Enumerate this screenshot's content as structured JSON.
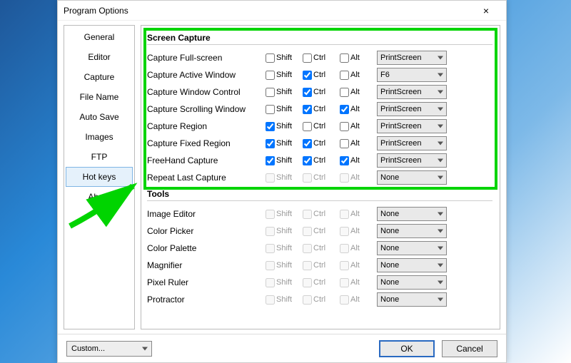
{
  "window": {
    "title": "Program Options",
    "close": "×"
  },
  "tabs": [
    {
      "label": "General"
    },
    {
      "label": "Editor"
    },
    {
      "label": "Capture"
    },
    {
      "label": "File Name"
    },
    {
      "label": "Auto Save"
    },
    {
      "label": "Images"
    },
    {
      "label": "FTP"
    },
    {
      "label": "Hot keys",
      "selected": true
    },
    {
      "label": "About"
    }
  ],
  "modlabels": {
    "shift": "Shift",
    "ctrl": "Ctrl",
    "alt": "Alt"
  },
  "groups": [
    {
      "title": "Screen Capture",
      "highlighted": true,
      "rows": [
        {
          "label": "Capture Full-screen",
          "shift": false,
          "ctrl": false,
          "alt": false,
          "key": "PrintScreen",
          "enabled": true
        },
        {
          "label": "Capture Active Window",
          "shift": false,
          "ctrl": true,
          "alt": false,
          "key": "F6",
          "enabled": true
        },
        {
          "label": "Capture Window Control",
          "shift": false,
          "ctrl": true,
          "alt": false,
          "key": "PrintScreen",
          "enabled": true
        },
        {
          "label": "Capture Scrolling Window",
          "shift": false,
          "ctrl": true,
          "alt": true,
          "key": "PrintScreen",
          "enabled": true
        },
        {
          "label": "Capture Region",
          "shift": true,
          "ctrl": false,
          "alt": false,
          "key": "PrintScreen",
          "enabled": true
        },
        {
          "label": "Capture Fixed Region",
          "shift": true,
          "ctrl": true,
          "alt": false,
          "key": "PrintScreen",
          "enabled": true
        },
        {
          "label": "FreeHand Capture",
          "shift": true,
          "ctrl": true,
          "alt": true,
          "key": "PrintScreen",
          "enabled": true
        },
        {
          "label": "Repeat Last Capture",
          "shift": false,
          "ctrl": false,
          "alt": false,
          "key": "None",
          "enabled": false
        }
      ]
    },
    {
      "title": "Tools",
      "highlighted": false,
      "rows": [
        {
          "label": "Image Editor",
          "shift": false,
          "ctrl": false,
          "alt": false,
          "key": "None",
          "enabled": false
        },
        {
          "label": "Color Picker",
          "shift": false,
          "ctrl": false,
          "alt": false,
          "key": "None",
          "enabled": false
        },
        {
          "label": "Color Palette",
          "shift": false,
          "ctrl": false,
          "alt": false,
          "key": "None",
          "enabled": false
        },
        {
          "label": "Magnifier",
          "shift": false,
          "ctrl": false,
          "alt": false,
          "key": "None",
          "enabled": false
        },
        {
          "label": "Pixel Ruler",
          "shift": false,
          "ctrl": false,
          "alt": false,
          "key": "None",
          "enabled": false
        },
        {
          "label": "Protractor",
          "shift": false,
          "ctrl": false,
          "alt": false,
          "key": "None",
          "enabled": false
        }
      ]
    }
  ],
  "footer": {
    "preset": "Custom...",
    "ok": "OK",
    "cancel": "Cancel"
  }
}
